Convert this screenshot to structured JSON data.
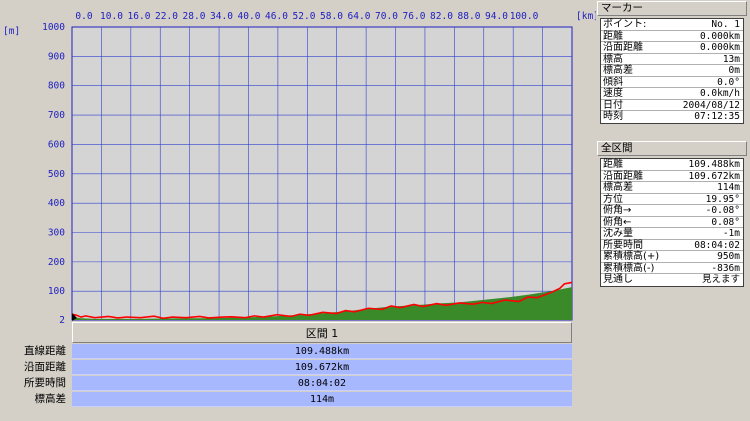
{
  "chart_data": {
    "type": "area",
    "xlabel_unit": "[km]",
    "ylabel_unit": "[m]",
    "x_ticks": [
      "0.0",
      "10.0",
      "16.0",
      "22.0",
      "28.0",
      "34.0",
      "40.0",
      "46.0",
      "52.0",
      "58.0",
      "64.0",
      "70.0",
      "76.0",
      "82.0",
      "88.0",
      "94.0",
      "100.0"
    ],
    "y_ticks": [
      "1000",
      "900",
      "800",
      "700",
      "600",
      "500",
      "400",
      "300",
      "200",
      "100",
      "2"
    ],
    "xlim": [
      0,
      109.67
    ],
    "ylim": [
      2,
      1000
    ],
    "grid": true,
    "series": [
      {
        "color": "#3a8a2a",
        "x": [
          0,
          2,
          5,
          10,
          15,
          20,
          25,
          30,
          35,
          40,
          45,
          50,
          55,
          60,
          65,
          70,
          75,
          80,
          85,
          90,
          95,
          100,
          105,
          109.67
        ],
        "values": [
          12,
          8,
          6,
          6,
          6,
          7,
          8,
          8,
          10,
          12,
          15,
          20,
          25,
          32,
          40,
          48,
          52,
          58,
          62,
          70,
          78,
          88,
          100,
          114
        ]
      },
      {
        "color": "#ff0000",
        "x": [
          0,
          1,
          2,
          3,
          5,
          8,
          10,
          12,
          15,
          18,
          20,
          22,
          25,
          28,
          30,
          33,
          35,
          38,
          40,
          42,
          45,
          48,
          50,
          52,
          55,
          58,
          60,
          62,
          65,
          68,
          70,
          72,
          75,
          77,
          80,
          82,
          85,
          88,
          90,
          92,
          95,
          98,
          100,
          102,
          105,
          107,
          108,
          109.67
        ],
        "values": [
          22,
          18,
          12,
          16,
          10,
          14,
          9,
          12,
          10,
          15,
          8,
          12,
          10,
          14,
          9,
          12,
          13,
          10,
          16,
          12,
          20,
          14,
          22,
          18,
          28,
          24,
          34,
          30,
          42,
          38,
          50,
          44,
          55,
          48,
          58,
          52,
          60,
          56,
          62,
          58,
          70,
          65,
          80,
          78,
          95,
          110,
          125,
          130
        ]
      }
    ]
  },
  "section": {
    "label": "区間 1"
  },
  "summary": [
    {
      "label": "直線距離",
      "value": "109.488km"
    },
    {
      "label": "沿面距離",
      "value": "109.672km"
    },
    {
      "label": "所要時間",
      "value": "08:04:02"
    },
    {
      "label": "標高差",
      "value": "114m"
    }
  ],
  "marker_panel": {
    "title": "マーカー",
    "rows": [
      {
        "label": "ポイント:",
        "value": "No. 1"
      },
      {
        "label": "距離",
        "value": "0.000km"
      },
      {
        "label": "沿面距離",
        "value": "0.000km"
      },
      {
        "label": "標高",
        "value": "13m"
      },
      {
        "label": "標高差",
        "value": "0m"
      },
      {
        "label": "傾斜",
        "value": "0.0°"
      },
      {
        "label": "速度",
        "value": "0.0km/h"
      },
      {
        "label": "日付",
        "value": "2004/08/12"
      },
      {
        "label": "時刻",
        "value": "07:12:35"
      }
    ]
  },
  "total_panel": {
    "title": "全区間",
    "rows": [
      {
        "label": "距離",
        "value": "109.488km"
      },
      {
        "label": "沿面距離",
        "value": "109.672km"
      },
      {
        "label": "標高差",
        "value": "114m"
      },
      {
        "label": "方位",
        "value": "19.95°"
      },
      {
        "label": "俯角→",
        "value": "-0.08°"
      },
      {
        "label": "俯角←",
        "value": "0.08°"
      },
      {
        "label": "沈み量",
        "value": "-1m"
      },
      {
        "label": "所要時間",
        "value": "08:04:02"
      },
      {
        "label": "累積標高(+)",
        "value": "950m"
      },
      {
        "label": "累積標高(-)",
        "value": "-836m"
      },
      {
        "label": "見通し",
        "value": "見えます"
      }
    ]
  }
}
